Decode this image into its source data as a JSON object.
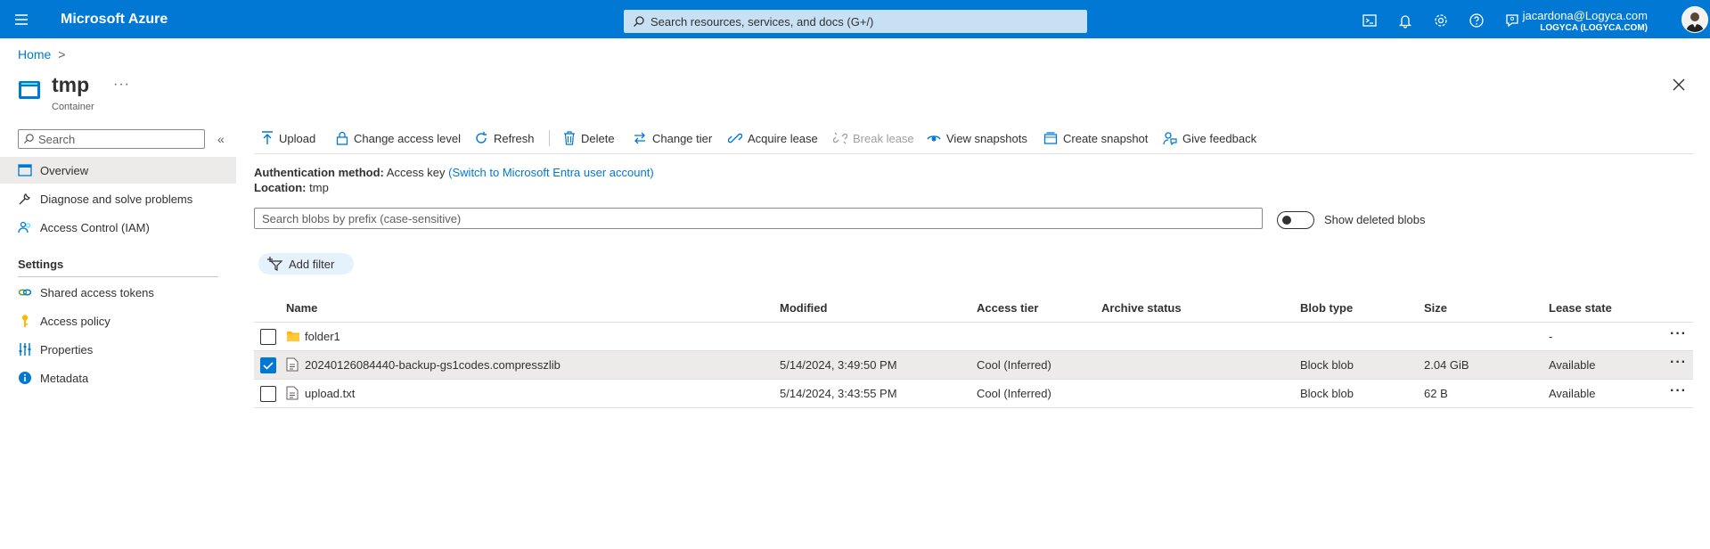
{
  "topbar": {
    "brand": "Microsoft Azure",
    "search_placeholder": "Search resources, services, and docs (G+/)",
    "account_email": "jacardona@Logyca.com",
    "account_org": "LOGYCA (LOGYCA.COM)",
    "icons": [
      "cloud-shell-icon",
      "notifications-icon",
      "settings-icon",
      "help-icon",
      "feedback-icon"
    ]
  },
  "breadcrumb": {
    "home": "Home",
    "separator": ">"
  },
  "header": {
    "title": "tmp",
    "subtitle": "Container",
    "more": "···"
  },
  "sidebar": {
    "search_placeholder": "Search",
    "collapse": "«",
    "items": [
      {
        "label": "Overview",
        "icon": "overview-icon",
        "active": true
      },
      {
        "label": "Diagnose and solve problems",
        "icon": "wrench-icon"
      },
      {
        "label": "Access Control (IAM)",
        "icon": "people-icon"
      }
    ],
    "settings_heading": "Settings",
    "settings_items": [
      {
        "label": "Shared access tokens",
        "icon": "link-icon"
      },
      {
        "label": "Access policy",
        "icon": "key-icon"
      },
      {
        "label": "Properties",
        "icon": "properties-icon"
      },
      {
        "label": "Metadata",
        "icon": "info-icon"
      }
    ]
  },
  "toolbar": {
    "upload": "Upload",
    "change_access": "Change access level",
    "refresh": "Refresh",
    "delete": "Delete",
    "change_tier": "Change tier",
    "acquire_lease": "Acquire lease",
    "break_lease": "Break lease",
    "view_snapshots": "View snapshots",
    "create_snapshot": "Create snapshot",
    "give_feedback": "Give feedback"
  },
  "info": {
    "auth_label": "Authentication method:",
    "auth_value": "Access key",
    "auth_link": "(Switch to Microsoft Entra user account)",
    "location_label": "Location:",
    "location_value": "tmp"
  },
  "blob_search": {
    "placeholder": "Search blobs by prefix (case-sensitive)"
  },
  "show_deleted": {
    "label": "Show deleted blobs",
    "on": false
  },
  "filter": {
    "label": "Add filter"
  },
  "table": {
    "columns": [
      "Name",
      "Modified",
      "Access tier",
      "Archive status",
      "Blob type",
      "Size",
      "Lease state"
    ],
    "rows": [
      {
        "name": "folder1",
        "type": "folder",
        "modified": "",
        "tier": "",
        "archive": "",
        "blob_type": "",
        "size": "",
        "lease": "-",
        "checked": false
      },
      {
        "name": "20240126084440-backup-gs1codes.compresszlib",
        "type": "file",
        "modified": "5/14/2024, 3:49:50 PM",
        "tier": "Cool (Inferred)",
        "archive": "",
        "blob_type": "Block blob",
        "size": "2.04 GiB",
        "lease": "Available",
        "checked": true
      },
      {
        "name": "upload.txt",
        "type": "file",
        "modified": "5/14/2024, 3:43:55 PM",
        "tier": "Cool (Inferred)",
        "archive": "",
        "blob_type": "Block blob",
        "size": "62 B",
        "lease": "Available",
        "checked": false
      }
    ],
    "row_more": "···"
  },
  "colors": {
    "accent": "#0078d4",
    "folder": "#ffb900",
    "selected_row": "#edebe9"
  }
}
